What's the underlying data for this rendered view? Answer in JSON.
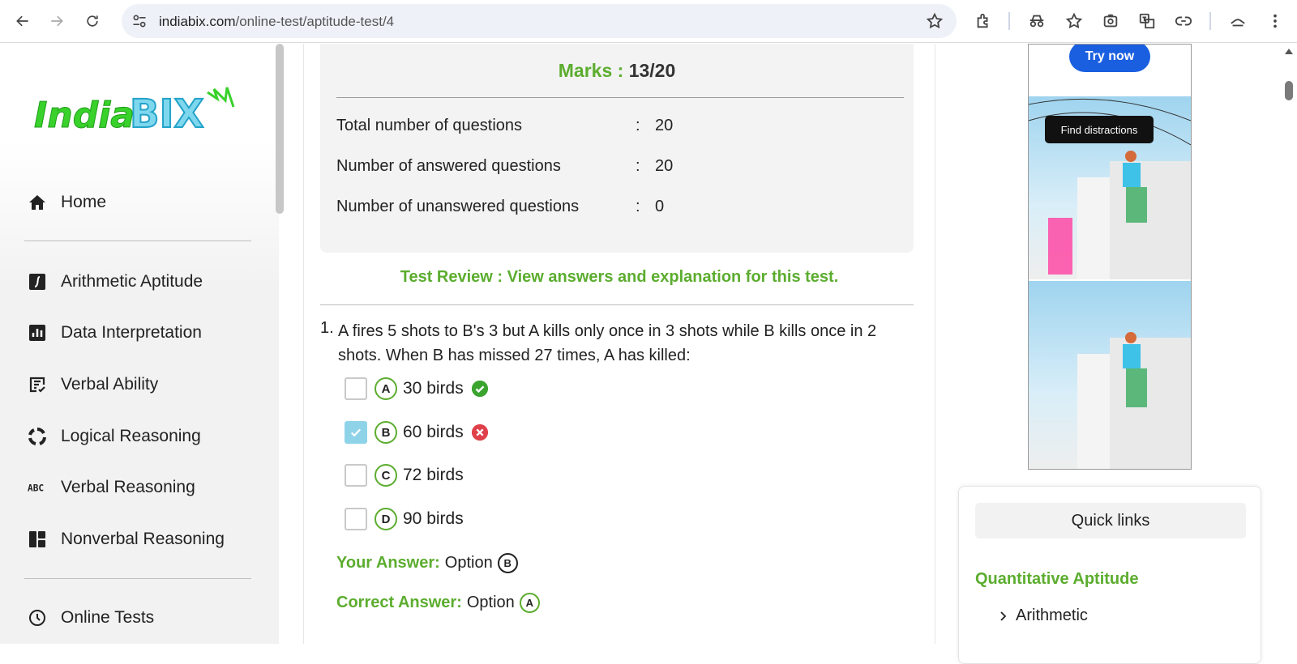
{
  "browser": {
    "url_domain": "indiabix.com",
    "url_path": "/online-test/aptitude-test/4"
  },
  "sidebar": {
    "logo_text": "IndiaBIX",
    "items": [
      {
        "label": "Home",
        "icon": "home-icon"
      },
      {
        "label": "Arithmetic Aptitude",
        "icon": "integral-icon"
      },
      {
        "label": "Data Interpretation",
        "icon": "bar-chart-icon"
      },
      {
        "label": "Verbal Ability",
        "icon": "document-check-icon"
      },
      {
        "label": "Logical Reasoning",
        "icon": "cycle-icon"
      },
      {
        "label": "Verbal Reasoning",
        "icon": "abc-icon"
      },
      {
        "label": "Nonverbal Reasoning",
        "icon": "dashboard-icon"
      },
      {
        "label": "Online Tests",
        "icon": "clock-icon"
      }
    ]
  },
  "result": {
    "marks_label": "Marks :",
    "marks_value": "13/20",
    "stats": [
      {
        "label": "Total number of questions",
        "colon": ":",
        "value": "20"
      },
      {
        "label": "Number of answered questions",
        "colon": ":",
        "value": "20"
      },
      {
        "label": "Number of unanswered questions",
        "colon": ":",
        "value": "0"
      }
    ],
    "review_text": "Test Review : View answers and explanation for this test."
  },
  "question": {
    "number": "1.",
    "text": "A fires 5 shots to B's 3 but A kills only once in 3 shots while B kills once in 2 shots. When B has missed 27 times, A has killed:",
    "options": [
      {
        "letter": "A",
        "text": "30 birds",
        "checked": false,
        "status": "correct"
      },
      {
        "letter": "B",
        "text": "60 birds",
        "checked": true,
        "status": "wrong"
      },
      {
        "letter": "C",
        "text": "72 birds",
        "checked": false,
        "status": "none"
      },
      {
        "letter": "D",
        "text": "90 birds",
        "checked": false,
        "status": "none"
      }
    ],
    "your_answer_label": "Your Answer:",
    "your_answer_value": "Option",
    "your_answer_letter": "B",
    "correct_answer_label": "Correct Answer:",
    "correct_answer_value": "Option",
    "correct_answer_letter": "A"
  },
  "ad": {
    "try_label": "Try now",
    "find_label": "Find distractions"
  },
  "quick_links": {
    "title": "Quick links",
    "section": "Quantitative Aptitude",
    "item": "Arithmetic"
  },
  "colors": {
    "accent_green": "#5cad2f",
    "correct": "#3aa42e",
    "wrong": "#e0404a",
    "ad_button": "#1a5fe0"
  }
}
